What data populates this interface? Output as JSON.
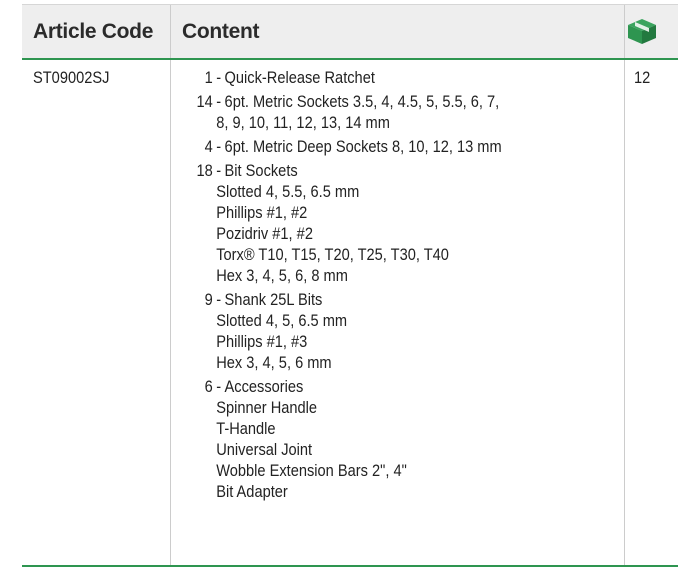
{
  "table": {
    "headers": {
      "code": "Article Code",
      "content": "Content"
    },
    "qty_icon": "box-icon",
    "colors": {
      "accent": "#2e9550",
      "header_bg": "#eeeeee"
    },
    "row": {
      "article_code": "ST09002SJ",
      "quantity": "12",
      "items": [
        {
          "qty": "1",
          "label": "Quick-Release Ratchet",
          "lines": []
        },
        {
          "qty": "14",
          "label": "6pt. Metric Sockets 3.5, 4, 4.5, 5, 5.5, 6, 7,",
          "lines": [
            "8, 9, 10, 11, 12, 13, 14 mm"
          ]
        },
        {
          "qty": "4",
          "label": "6pt. Metric Deep Sockets 8, 10, 12, 13 mm",
          "lines": []
        },
        {
          "qty": "18",
          "label": "Bit Sockets",
          "lines": [
            "Slotted 4, 5.5, 6.5 mm",
            "Phillips #1, #2",
            "Pozidriv #1, #2",
            "Torx® T10, T15, T20, T25, T30, T40",
            "Hex 3, 4, 5, 6, 8 mm"
          ]
        },
        {
          "qty": "9",
          "label": "Shank 25L Bits",
          "lines": [
            "Slotted 4, 5, 6.5 mm",
            "Phillips #1, #3",
            "Hex 3, 4, 5, 6 mm"
          ]
        },
        {
          "qty": "6",
          "label": "Accessories",
          "lines": [
            "Spinner Handle",
            "T-Handle",
            "Universal Joint",
            "Wobble Extension Bars 2\", 4\"",
            "Bit Adapter"
          ]
        }
      ]
    }
  }
}
